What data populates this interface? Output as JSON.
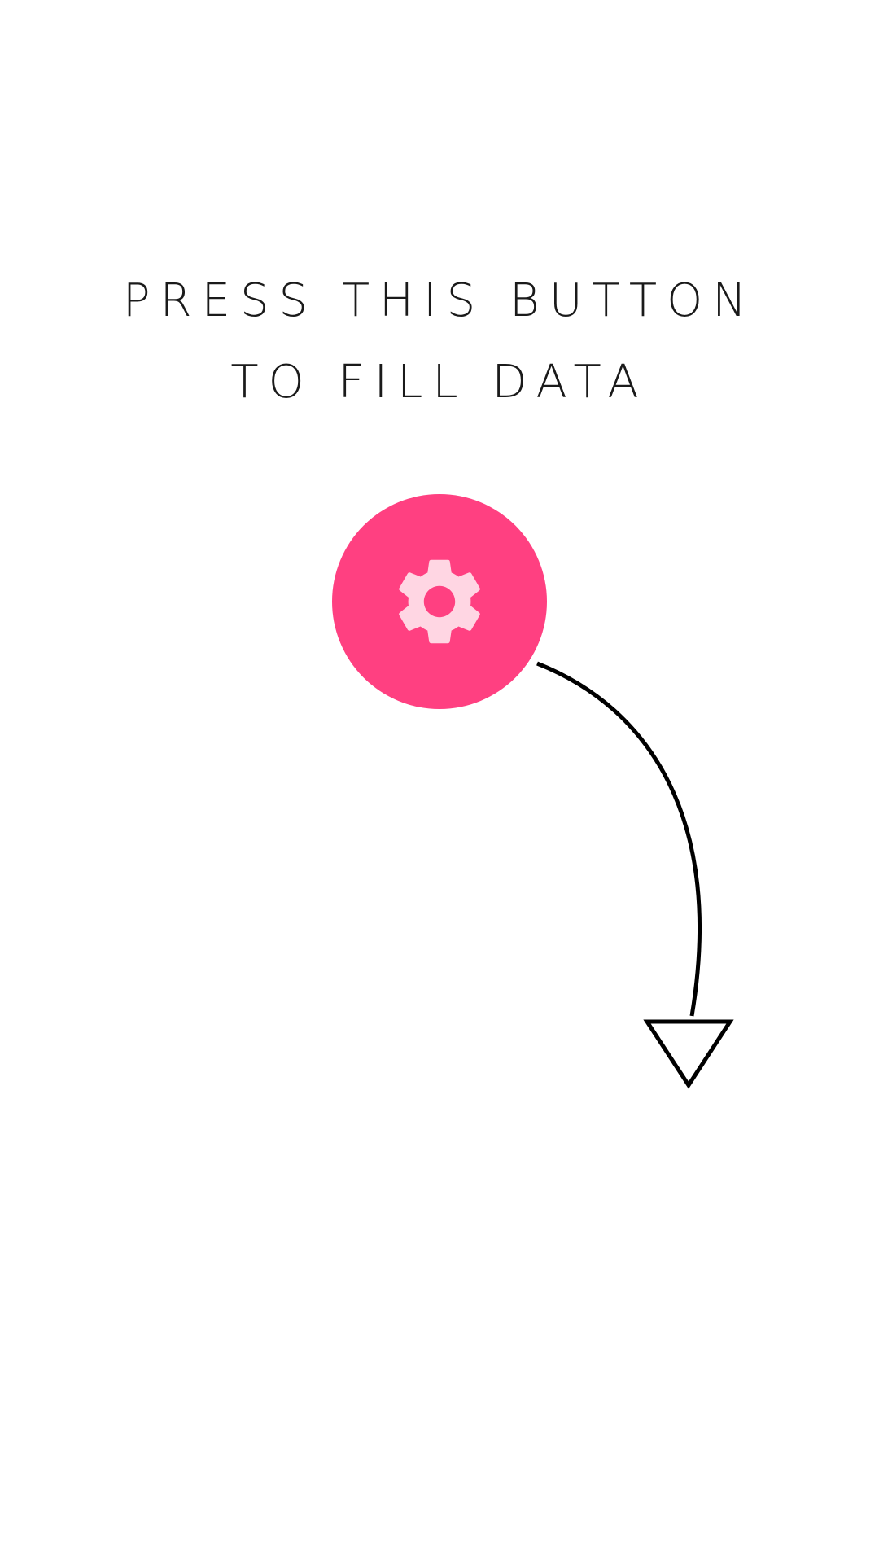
{
  "instruction": {
    "line1": "PRESS THIS BUTTON",
    "line2": "TO FILL DATA"
  },
  "fab": {
    "icon": "settings-gear-icon",
    "background_color": "#ff4081",
    "icon_color": "#ffd6e3"
  },
  "hint_arrow": {
    "icon": "curved-arrow-down-icon",
    "color": "#000000"
  }
}
